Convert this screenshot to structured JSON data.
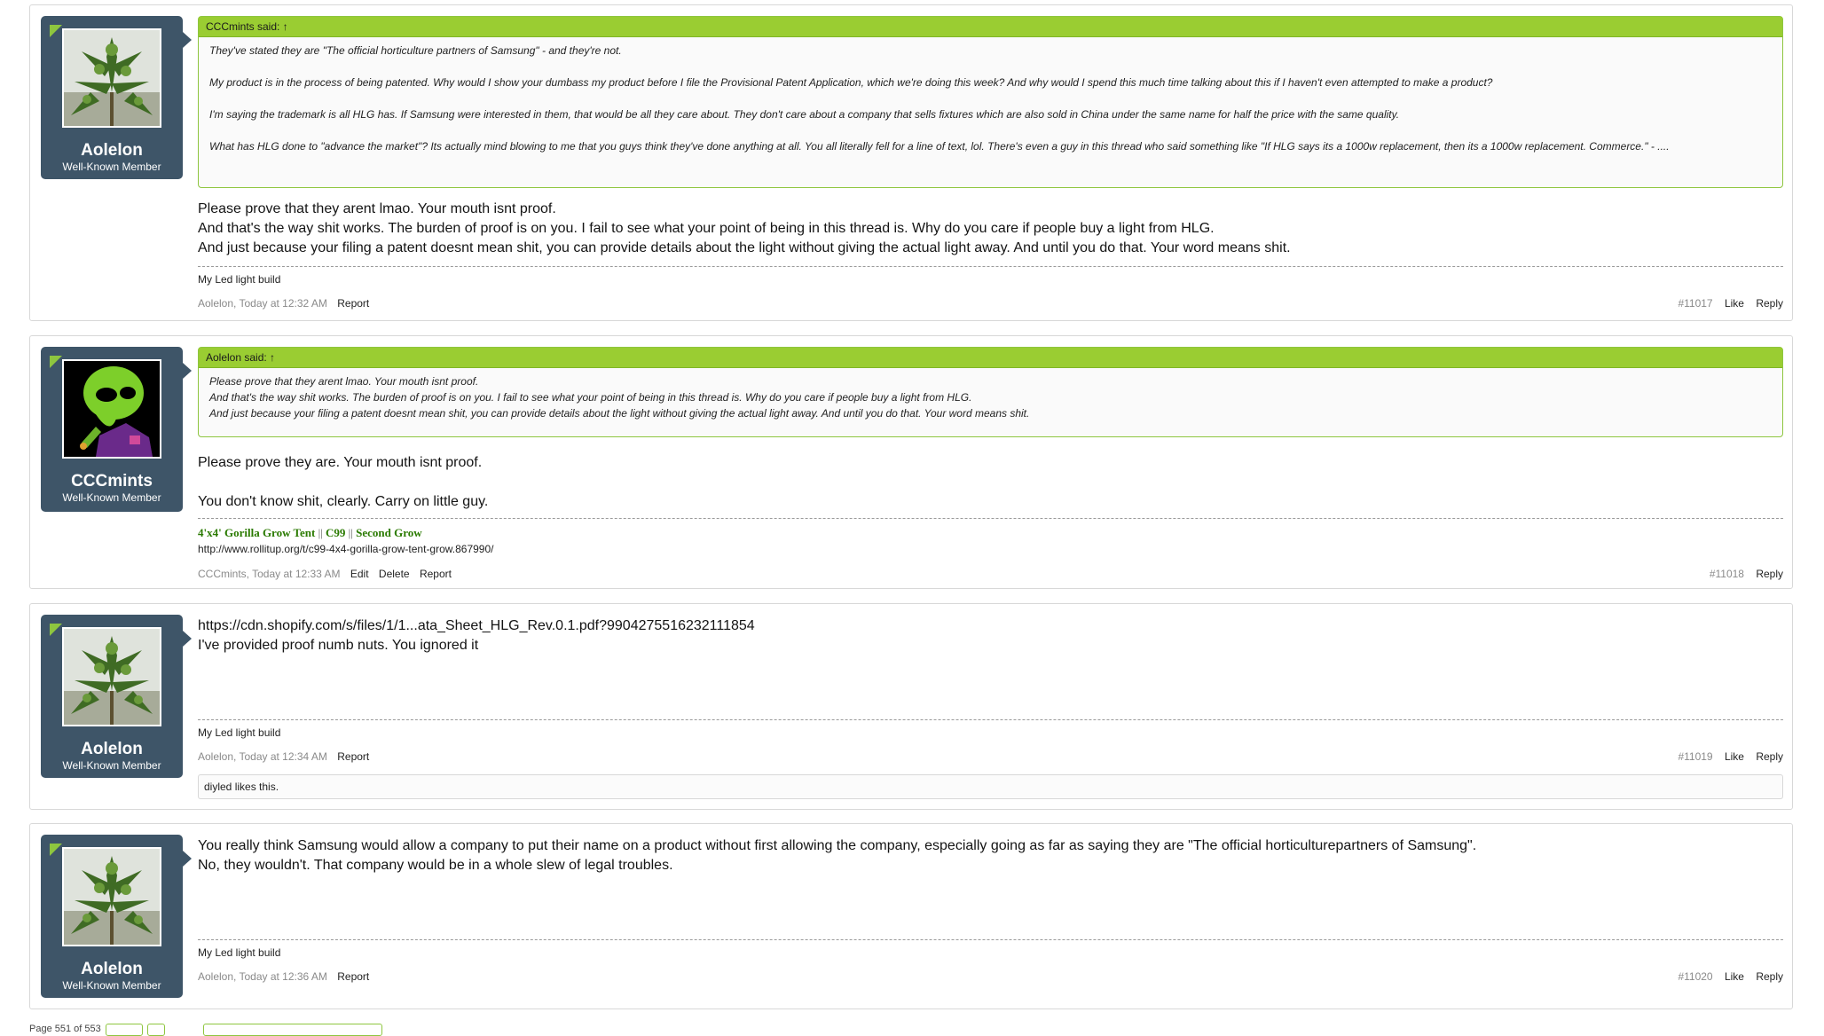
{
  "colors": {
    "accent": "#8ec63f",
    "user_block": "#3e5568",
    "quote_head": "#9acd32"
  },
  "posts": [
    {
      "user": "Aolelon",
      "title": "Well-Known Member",
      "avatar": "cannabis-plant-avatar",
      "quote_author": "CCCmints said: ↑",
      "quote_lines": [
        "They've stated they are \"The official horticulture partners of Samsung\" - and they're not.",
        "My product is in the process of being patented. Why would I show your dumbass my product before I file the Provisional Patent Application, which we're doing this week? And why would I spend this much time talking about this if I haven't even attempted to make a product?",
        "I'm saying the trademark is all HLG has. If Samsung were interested in them, that would be all they care about. They don't care about a company that sells fixtures which are also sold in China under the same name for half the price with the same quality.",
        "What has HLG done to \"advance the market\"? Its actually mind blowing to me that you guys think they've done anything at all. You all literally fell for a line of text, lol. There's even a guy in this thread who said something like \"If HLG says its a 1000w replacement, then its a 1000w replacement. Commerce.\" - ...."
      ],
      "message_lines": [
        "Please prove that they arent lmao. Your mouth isnt proof.",
        "And that's the way shit works. The burden of proof is on you. I fail to see what your point of being in this thread is. Why do you care if people buy a light from HLG.",
        "And just because your filing a patent doesnt mean shit, you can provide details about the light without giving the actual light away. And until you do that. Your word means shit."
      ],
      "signature": "My Led light build",
      "meta": "Aolelon, Today at 12:32 AM",
      "report": "Report",
      "post_no": "#11017",
      "like": "Like",
      "reply": "Reply"
    },
    {
      "user": "CCCmints",
      "title": "Well-Known Member",
      "avatar": "alien-character-avatar",
      "quote_author": "Aolelon said: ↑",
      "quote_lines": [
        "Please prove that they arent lmao. Your mouth isnt proof.",
        "And that's the way shit works. The burden of proof is on you. I fail to see what your point of being in this thread is. Why do you care if people buy a light from HLG.",
        "And just because your filing a patent doesnt mean shit, you can provide details about the light without giving the actual light away. And until you do that. Your word means shit."
      ],
      "message_lines": [
        "Please prove they are. Your mouth isnt proof.",
        "You don't know shit, clearly. Carry on little guy."
      ],
      "sig_links": [
        "4'x4' Gorilla Grow Tent",
        "C99",
        "Second Grow"
      ],
      "sig_sep": " || ",
      "sig_url": "http://www.rollitup.org/t/c99-4x4-gorilla-grow-tent-grow.867990/",
      "meta": "CCCmints, Today at 12:33 AM",
      "edit": "Edit",
      "delete": "Delete",
      "report": "Report",
      "post_no": "#11018",
      "reply": "Reply"
    },
    {
      "user": "Aolelon",
      "title": "Well-Known Member",
      "avatar": "cannabis-plant-avatar",
      "message_lines": [
        "https://cdn.shopify.com/s/files/1/1...ata_Sheet_HLG_Rev.0.1.pdf?9904275516232111854",
        "I've provided proof numb nuts. You ignored it"
      ],
      "signature": "My Led light build",
      "meta": "Aolelon, Today at 12:34 AM",
      "report": "Report",
      "post_no": "#11019",
      "like": "Like",
      "reply": "Reply",
      "likes": "diyled likes this."
    },
    {
      "user": "Aolelon",
      "title": "Well-Known Member",
      "avatar": "cannabis-plant-avatar",
      "message_lines": [
        "You really think Samsung would allow a company to put their name on a product without first allowing the company, especially going as far as saying they are \"The official horticulturepartners of Samsung\".",
        "No, they wouldn't. That company would be in a whole slew of legal troubles."
      ],
      "signature": "My Led light build",
      "meta": "Aolelon, Today at 12:36 AM",
      "report": "Report",
      "post_no": "#11020",
      "like": "Like",
      "reply": "Reply"
    }
  ],
  "pager": {
    "label": "Page 551 of 553"
  }
}
